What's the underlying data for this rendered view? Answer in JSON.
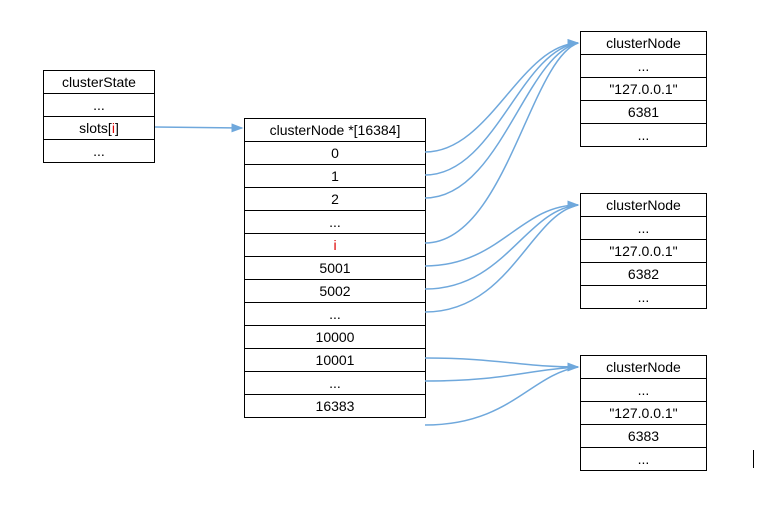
{
  "clusterState": {
    "title": "clusterState",
    "row_dots0": "...",
    "slots_label_prefix": "slots[",
    "slots_label_i": "i",
    "slots_label_suffix": "]",
    "row_dots1": "..."
  },
  "slotsArray": {
    "title": "clusterNode *[16384]",
    "rows": [
      "0",
      "1",
      "2",
      "...",
      "i",
      "5001",
      "5002",
      "...",
      "10000",
      "10001",
      "...",
      "16383"
    ]
  },
  "nodes": [
    {
      "title": "clusterNode",
      "dots0": "...",
      "ip": "\"127.0.0.1\"",
      "port": "6381",
      "dots1": "..."
    },
    {
      "title": "clusterNode",
      "dots0": "...",
      "ip": "\"127.0.0.1\"",
      "port": "6382",
      "dots1": "..."
    },
    {
      "title": "clusterNode",
      "dots0": "...",
      "ip": "\"127.0.0.1\"",
      "port": "6383",
      "dots1": "..."
    }
  ]
}
